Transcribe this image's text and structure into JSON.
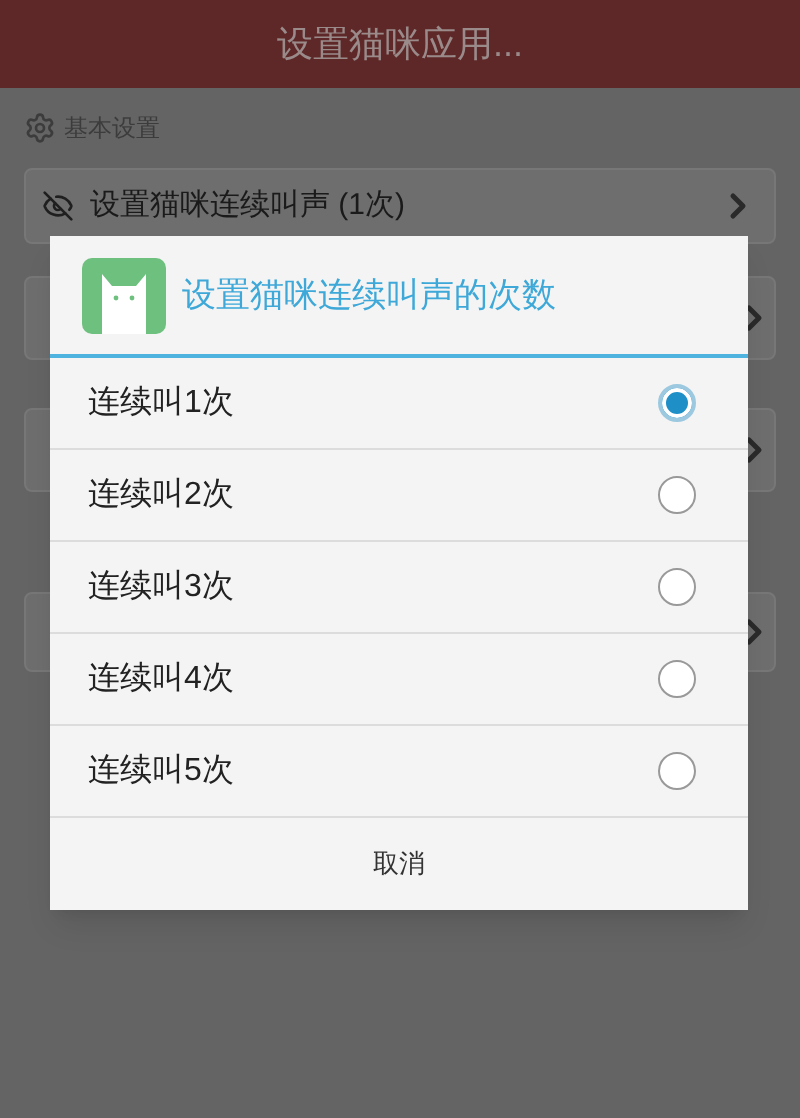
{
  "app_bar": {
    "title": "设置猫咪应用..."
  },
  "section": {
    "title": "基本设置"
  },
  "setting_row": {
    "label": "设置猫咪连续叫声 (1次)"
  },
  "dialog": {
    "title": "设置猫咪连续叫声的次数",
    "options": [
      {
        "label": "连续叫1次",
        "selected": true
      },
      {
        "label": "连续叫2次",
        "selected": false
      },
      {
        "label": "连续叫3次",
        "selected": false
      },
      {
        "label": "连续叫4次",
        "selected": false
      },
      {
        "label": "连续叫5次",
        "selected": false
      }
    ],
    "cancel": "取消"
  }
}
